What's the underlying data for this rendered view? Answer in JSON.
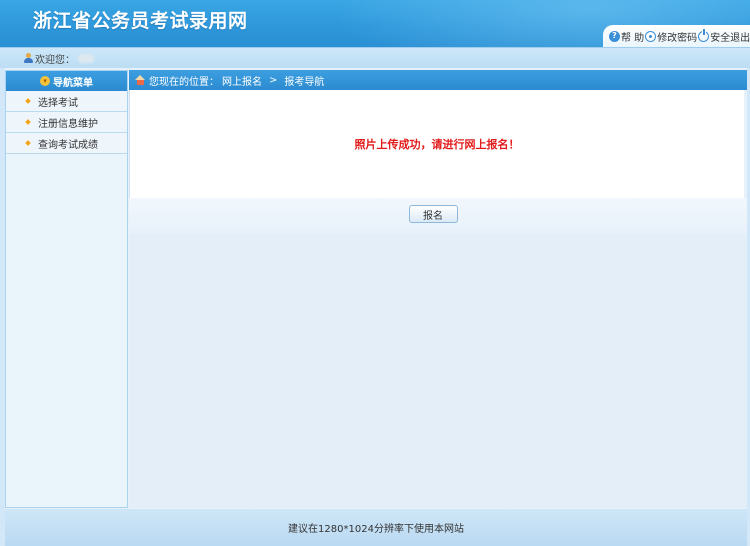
{
  "header": {
    "title": "浙江省公务员考试录用网",
    "actions": {
      "help_label": "帮 助",
      "change_password_label": "修改密码",
      "logout_label": "安全退出"
    }
  },
  "welcome": {
    "label": "欢迎您："
  },
  "sidebar": {
    "title": "导航菜单",
    "items": [
      {
        "label": "选择考试"
      },
      {
        "label": "注册信息维护"
      },
      {
        "label": "查询考试成绩"
      }
    ]
  },
  "main": {
    "breadcrumb": {
      "prefix": "您现在的位置：",
      "level1": "网上报名",
      "separator": ">",
      "level2": "报考导航"
    },
    "message": "照片上传成功，请进行网上报名！",
    "apply_button": "报名"
  },
  "footer": {
    "text": "建议在1280*1024分辨率下使用本网站"
  },
  "colors": {
    "header_blue": "#2e98db",
    "message_red": "#e21b1b",
    "nav_bullet": "#f2a41b"
  }
}
